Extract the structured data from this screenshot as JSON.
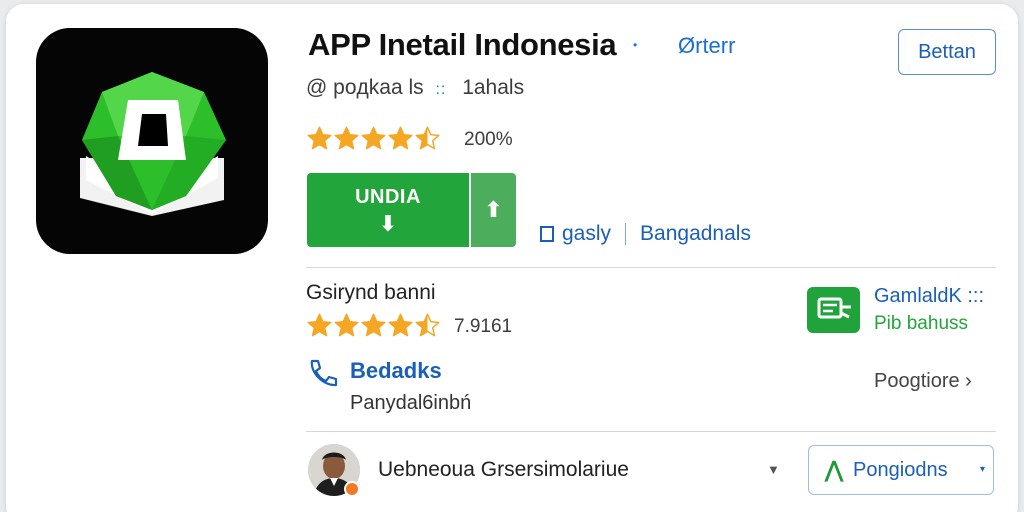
{
  "header": {
    "app_title": "APP Inetail Indonesia",
    "title_dot": "•",
    "developer_link": "Ørterr",
    "top_button": "Bettan",
    "subtitle_left": "@ poдkaa ls",
    "subtitle_sep": "::",
    "subtitle_right": "1ahals"
  },
  "rating": {
    "stars": 4.5,
    "text": "200%"
  },
  "install": {
    "label": "UNDIA",
    "arrow": "⬇",
    "extra_arrow": "⬆"
  },
  "meta_links": {
    "left": "gasly",
    "right": "Bangadnals"
  },
  "section": {
    "label": "Gsirynd banni",
    "stars": 4.5,
    "rating_text": "7.9161"
  },
  "promo": {
    "title": "GamlaldK :::",
    "subtitle": "Pib bahuss"
  },
  "contact": {
    "title": "Bedadks",
    "subtitle": "Panydal6inbń",
    "more_link": "Poogtiore ›"
  },
  "footer": {
    "text": "Uebneoua Grsersimolariue",
    "caret": "▼",
    "button_label": "Pongiodns",
    "button_icon": "⋀",
    "button_dot": "▾"
  },
  "colors": {
    "accent_blue": "#1a5fb8",
    "install_green": "#22a53a",
    "star_gold": "#f5a623"
  },
  "icons": [
    "app-logo-icon",
    "star-icon",
    "download-arrow-icon",
    "upload-arrow-icon",
    "document-icon",
    "phone-icon",
    "promo-icon",
    "chevron-right-icon",
    "avatar",
    "chevron-down-icon",
    "trend-icon"
  ]
}
